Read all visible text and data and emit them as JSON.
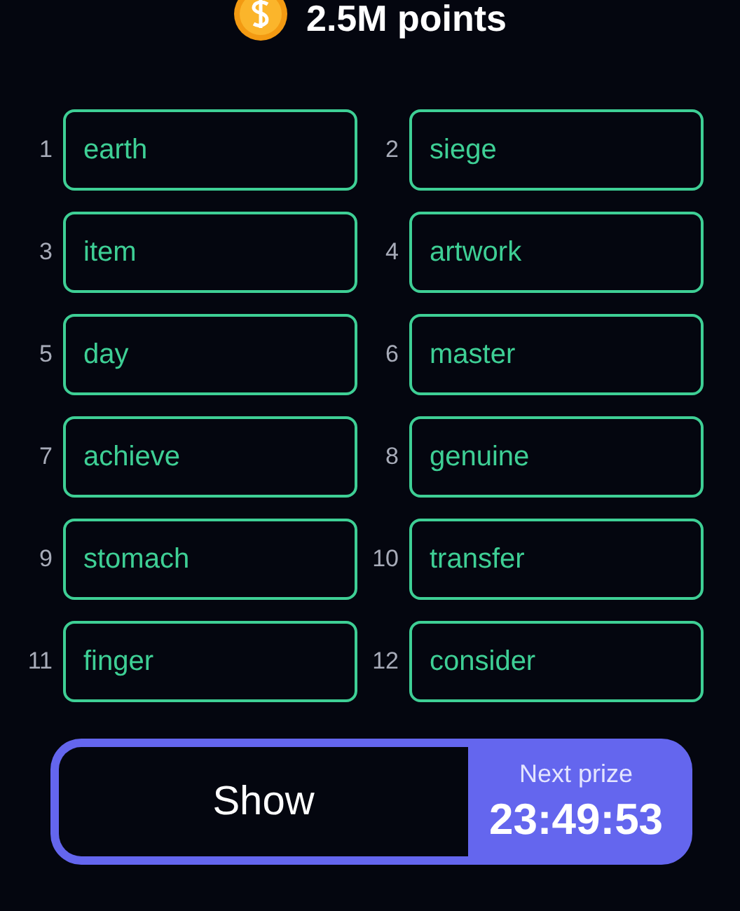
{
  "header": {
    "points": "2.5M points"
  },
  "words": [
    {
      "index": "1",
      "word": "earth"
    },
    {
      "index": "2",
      "word": "siege"
    },
    {
      "index": "3",
      "word": "item"
    },
    {
      "index": "4",
      "word": "artwork"
    },
    {
      "index": "5",
      "word": "day"
    },
    {
      "index": "6",
      "word": "master"
    },
    {
      "index": "7",
      "word": "achieve"
    },
    {
      "index": "8",
      "word": "genuine"
    },
    {
      "index": "9",
      "word": "stomach"
    },
    {
      "index": "10",
      "word": "transfer"
    },
    {
      "index": "11",
      "word": "finger"
    },
    {
      "index": "12",
      "word": "consider"
    }
  ],
  "show_button": {
    "label": "Show"
  },
  "prize": {
    "label": "Next prize",
    "timer": "23:49:53"
  }
}
